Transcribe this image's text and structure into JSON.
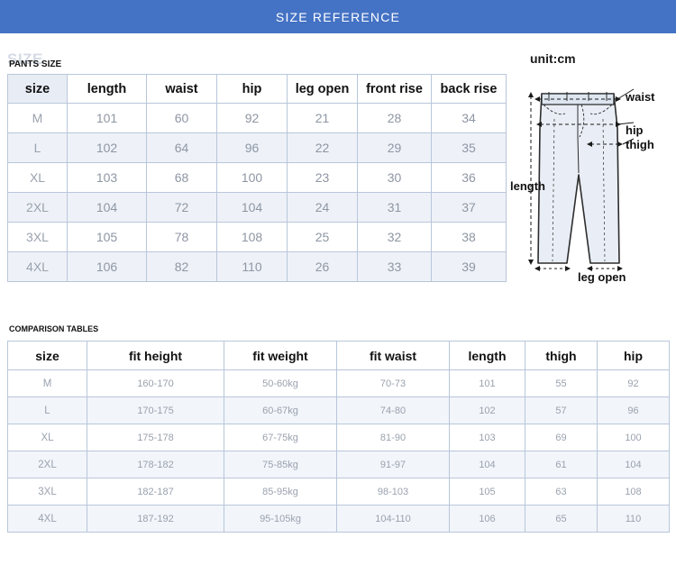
{
  "banner": {
    "title": "SIZE REFERENCE"
  },
  "unit": {
    "label": "unit:cm"
  },
  "ghost_text": "SIZE",
  "captions": {
    "pants": "PANTS SIZE",
    "comparison": "COMPARISON TABLES"
  },
  "pants_table": {
    "headers": [
      "size",
      "length",
      "waist",
      "hip",
      "leg open",
      "front rise",
      "back rise"
    ],
    "rows": [
      [
        "M",
        "101",
        "60",
        "92",
        "21",
        "28",
        "34"
      ],
      [
        "L",
        "102",
        "64",
        "96",
        "22",
        "29",
        "35"
      ],
      [
        "XL",
        "103",
        "68",
        "100",
        "23",
        "30",
        "36"
      ],
      [
        "2XL",
        "104",
        "72",
        "104",
        "24",
        "31",
        "37"
      ],
      [
        "3XL",
        "105",
        "78",
        "108",
        "25",
        "32",
        "38"
      ],
      [
        "4XL",
        "106",
        "82",
        "110",
        "26",
        "33",
        "39"
      ]
    ]
  },
  "comparison_table": {
    "headers": [
      "size",
      "fit height",
      "fit weight",
      "fit waist",
      "length",
      "thigh",
      "hip"
    ],
    "rows": [
      [
        "M",
        "160-170",
        "50-60kg",
        "70-73",
        "101",
        "55",
        "92"
      ],
      [
        "L",
        "170-175",
        "60-67kg",
        "74-80",
        "102",
        "57",
        "96"
      ],
      [
        "XL",
        "175-178",
        "67-75kg",
        "81-90",
        "103",
        "69",
        "100"
      ],
      [
        "2XL",
        "178-182",
        "75-85kg",
        "91-97",
        "104",
        "61",
        "104"
      ],
      [
        "3XL",
        "182-187",
        "85-95kg",
        "98-103",
        "105",
        "63",
        "108"
      ],
      [
        "4XL",
        "187-192",
        "95-105kg",
        "104-110",
        "106",
        "65",
        "110"
      ]
    ]
  },
  "diagram": {
    "labels": {
      "waist": "waist",
      "hip": "hip",
      "thigh": "thigh",
      "length": "length",
      "leg_open": "leg open"
    }
  },
  "colors": {
    "banner": "#4472c4",
    "grid": "#b9c6da",
    "row_alt": "#eef2f8",
    "text_muted": "#9aa2ae"
  }
}
